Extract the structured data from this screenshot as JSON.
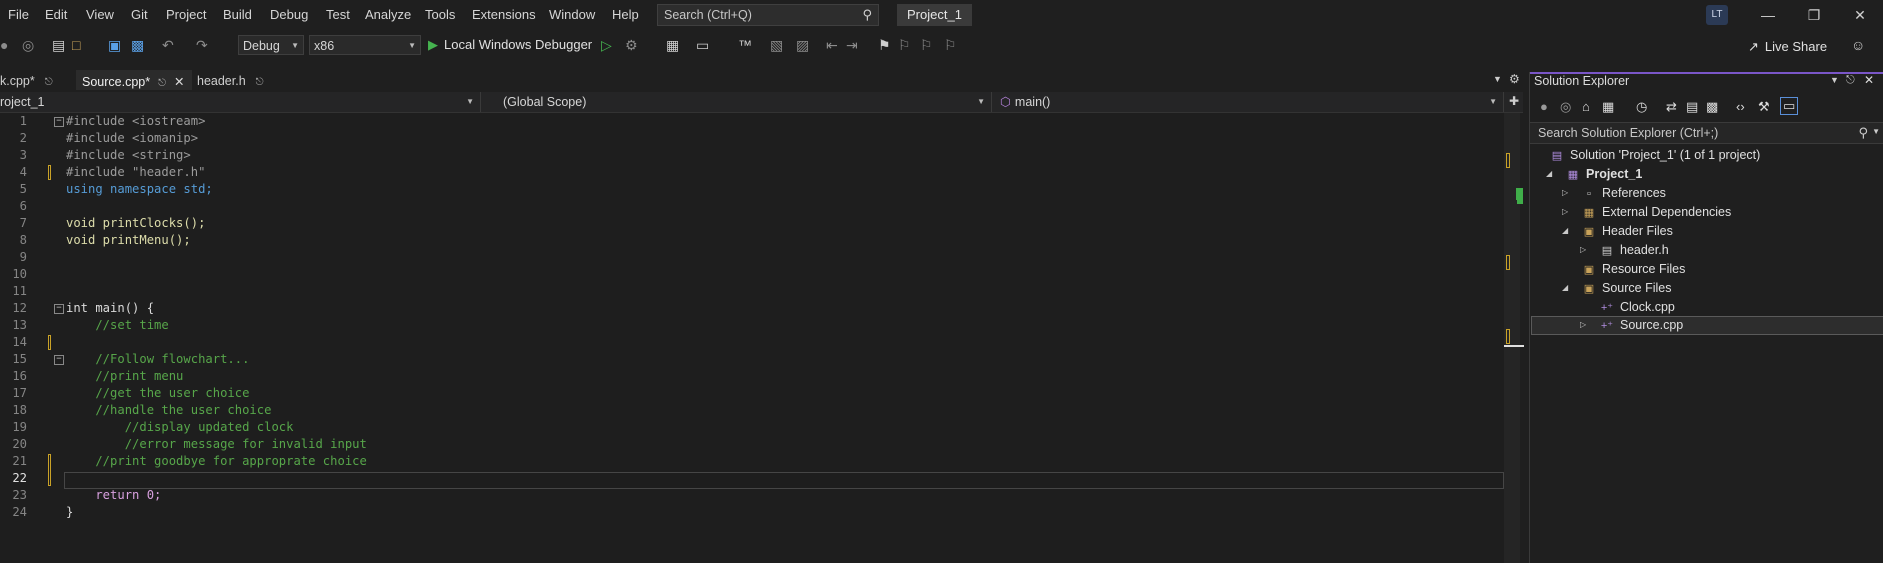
{
  "menu": [
    "File",
    "Edit",
    "View",
    "Git",
    "Project",
    "Build",
    "Debug",
    "Test",
    "Analyze",
    "Tools",
    "Extensions",
    "Window",
    "Help"
  ],
  "search": {
    "placeholder": "Search (Ctrl+Q)"
  },
  "project_badge": "Project_1",
  "avatar_initials": "LT",
  "toolbar": {
    "config": "Debug",
    "platform": "x86",
    "debugger": "Local Windows Debugger",
    "live_share": "Live Share"
  },
  "tabs": [
    {
      "label": "k.cpp*",
      "active": false
    },
    {
      "label": "Source.cpp*",
      "active": true
    },
    {
      "label": "header.h",
      "active": false
    }
  ],
  "navbar": {
    "project": "roject_1",
    "scope": "(Global Scope)",
    "member": "main()"
  },
  "editor": {
    "current_line": 22,
    "lines": [
      {
        "n": 1,
        "text": "#include <iostream>"
      },
      {
        "n": 2,
        "text": "#include <iomanip>"
      },
      {
        "n": 3,
        "text": "#include <string>"
      },
      {
        "n": 4,
        "text": "#include \"header.h\""
      },
      {
        "n": 5,
        "text": "using namespace std;"
      },
      {
        "n": 6,
        "text": ""
      },
      {
        "n": 7,
        "text": "void printClocks();"
      },
      {
        "n": 8,
        "text": "void printMenu();"
      },
      {
        "n": 9,
        "text": ""
      },
      {
        "n": 10,
        "text": ""
      },
      {
        "n": 11,
        "text": ""
      },
      {
        "n": 12,
        "text": "int main() {"
      },
      {
        "n": 13,
        "text": "    //set time"
      },
      {
        "n": 14,
        "text": ""
      },
      {
        "n": 15,
        "text": "    //Follow flowchart..."
      },
      {
        "n": 16,
        "text": "    //print menu"
      },
      {
        "n": 17,
        "text": "    //get the user choice"
      },
      {
        "n": 18,
        "text": "    //handle the user choice"
      },
      {
        "n": 19,
        "text": "        //display updated clock"
      },
      {
        "n": 20,
        "text": "        //error message for invalid input"
      },
      {
        "n": 21,
        "text": "    //print goodbye for approprate choice"
      },
      {
        "n": 22,
        "text": ""
      },
      {
        "n": 23,
        "text": "    return 0;"
      },
      {
        "n": 24,
        "text": "}"
      }
    ]
  },
  "solution_explorer": {
    "title": "Solution Explorer",
    "search_placeholder": "Search Solution Explorer (Ctrl+;)",
    "items": [
      {
        "label": "Solution 'Project_1' (1 of 1 project)",
        "depth": 0,
        "twisty": "",
        "icon": "solution-icon",
        "bold": false
      },
      {
        "label": "Project_1",
        "depth": 1,
        "twisty": "open",
        "icon": "project-icon",
        "bold": true
      },
      {
        "label": "References",
        "depth": 2,
        "twisty": "closed",
        "icon": "references-icon",
        "bold": false
      },
      {
        "label": "External Dependencies",
        "depth": 2,
        "twisty": "closed",
        "icon": "dependencies-icon",
        "bold": false
      },
      {
        "label": "Header Files",
        "depth": 2,
        "twisty": "open",
        "icon": "folder-icon",
        "bold": false
      },
      {
        "label": "header.h",
        "depth": 3,
        "twisty": "closed",
        "icon": "header-file-icon",
        "bold": false
      },
      {
        "label": "Resource Files",
        "depth": 2,
        "twisty": "",
        "icon": "folder-icon",
        "bold": false
      },
      {
        "label": "Source Files",
        "depth": 2,
        "twisty": "open",
        "icon": "folder-icon",
        "bold": false
      },
      {
        "label": "Clock.cpp",
        "depth": 3,
        "twisty": "",
        "icon": "cpp-file-icon",
        "bold": false
      },
      {
        "label": "Source.cpp",
        "depth": 3,
        "twisty": "closed",
        "icon": "cpp-file-icon",
        "bold": false,
        "selected": true
      }
    ]
  }
}
